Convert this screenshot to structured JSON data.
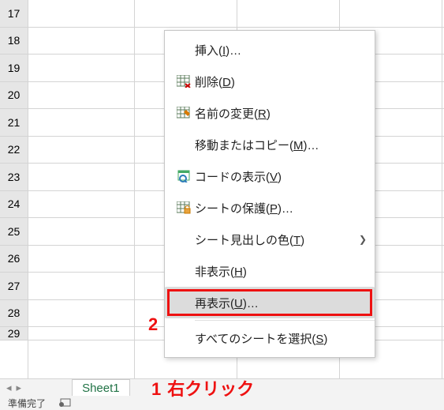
{
  "rows": [
    "17",
    "18",
    "19",
    "20",
    "21",
    "22",
    "23",
    "24",
    "25",
    "26",
    "27",
    "28",
    "29"
  ],
  "menu": {
    "insert": "挿入(I)…",
    "delete": "削除(D)",
    "rename": "名前の変更(R)",
    "move_copy": "移動またはコピー(M)…",
    "view_code": "コードの表示(V)",
    "protect": "シートの保護(P)…",
    "tab_color": "シート見出しの色(T)",
    "hide": "非表示(H)",
    "unhide": "再表示(U)…",
    "select_all": "すべてのシートを選択(S)"
  },
  "sheet_tab": "Sheet1",
  "status": "準備完了",
  "annotation1_num": "1",
  "annotation1_text": "右クリック",
  "annotation2_num": "2"
}
